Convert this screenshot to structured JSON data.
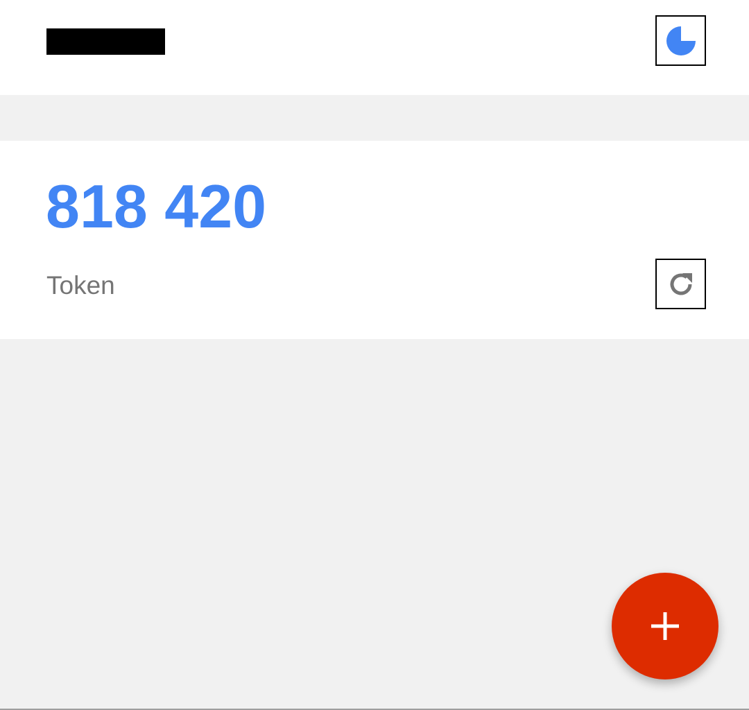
{
  "header": {
    "timer_icon": "countdown-pie-icon",
    "timer_fraction_elapsed": 0.25
  },
  "token_card": {
    "code": "818 420",
    "label": "Token",
    "refresh_icon": "refresh-icon"
  },
  "fab": {
    "icon": "plus-icon"
  },
  "colors": {
    "accent_blue": "#4285f4",
    "fab_red": "#dd2c00",
    "label_gray": "#757575",
    "icon_gray": "#757575"
  }
}
